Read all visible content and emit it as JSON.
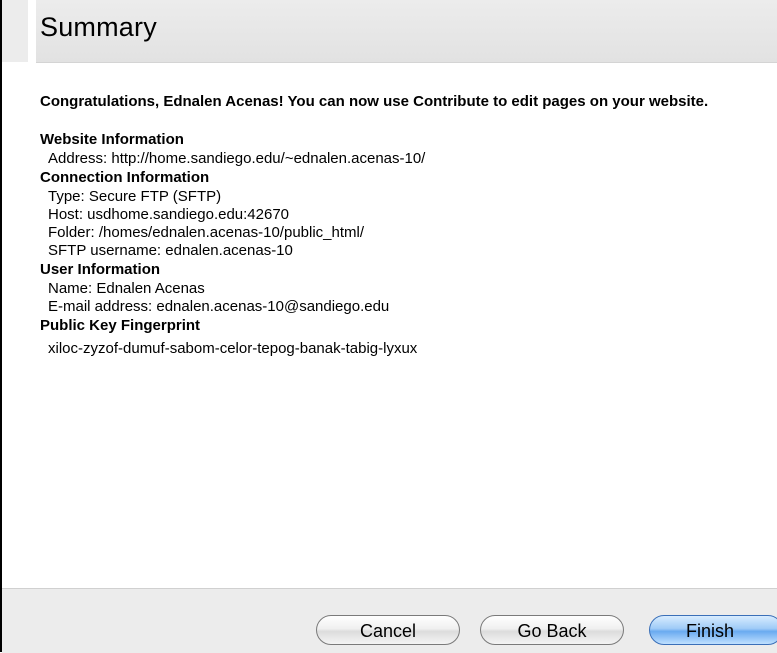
{
  "header": {
    "title": "Summary"
  },
  "content": {
    "congrats": "Congratulations, Ednalen Acenas! You can now use Contribute to edit pages on your website.",
    "sections": [
      {
        "heading": "Website Information",
        "lines": [
          "Address: http://home.sandiego.edu/~ednalen.acenas-10/"
        ]
      },
      {
        "heading": "Connection Information",
        "lines": [
          "Type: Secure FTP (SFTP)",
          "Host: usdhome.sandiego.edu:42670",
          "Folder: /homes/ednalen.acenas-10/public_html/",
          "SFTP username: ednalen.acenas-10"
        ]
      },
      {
        "heading": "User Information",
        "lines": [
          "Name: Ednalen Acenas",
          "E-mail address: ednalen.acenas-10@sandiego.edu"
        ]
      },
      {
        "heading": "Public Key Fingerprint",
        "lines": [
          "xiloc-zyzof-dumuf-sabom-celor-tepog-banak-tabig-lyxux"
        ]
      }
    ]
  },
  "footer": {
    "cancel_label": "Cancel",
    "back_label": "Go Back",
    "finish_label": "Finish"
  },
  "colors": {
    "header_bg": "#e6e6e6",
    "footer_bg": "#ececec",
    "default_button": "#8fc0f3"
  }
}
